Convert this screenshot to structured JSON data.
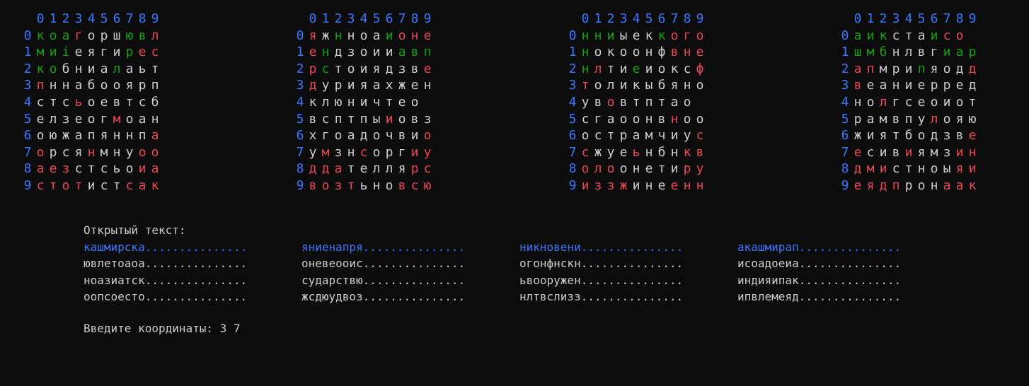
{
  "colors": {
    "background": "#0c0c0c",
    "text": "#cccccc",
    "index": "#3b78ff",
    "green": "#13a10e",
    "red": "#e74856"
  },
  "column_indices": [
    "0",
    "1",
    "2",
    "3",
    "4",
    "5",
    "6",
    "7",
    "8",
    "9"
  ],
  "row_indices": [
    "0",
    "1",
    "2",
    "3",
    "4",
    "5",
    "6",
    "7",
    "8",
    "9"
  ],
  "grids": [
    {
      "rows": [
        "коагоршювл",
        "миieягирес",
        "кобниалаьт",
        "пннабооярп",
        "стсьоевтсб",
        "елзеогмоан",
        "оюжапяннпа",
        "орсянмнуоо",
        "аезстсьоиа",
        "стотистсак"
      ],
      "colors": [
        "gggrwwwggrr",
        "gggwwwwgrrr",
        "ggwwwwgwwwr",
        "rwwwwwwwwww",
        "wwwrwwwwwww",
        "wwwwwwrwww",
        "wwwwwwwwwr",
        "rwwwrwwwrr",
        "rrrwwwwwrr",
        "rrrrwwwrrr"
      ]
    },
    {
      "rows": [
        "яжнноаионе",
        "ендзоииавп",
        "рстоиядзве",
        "дурияахжен",
        "клюничтео",
        "всптпыиовз",
        "хгоадочвио",
        "умзнсоргиу",
        "ддателлярс",
        "возтьновсю"
      ],
      "colors": [
        "rwgwwwgrrr",
        "rgwwwwwggg",
        "rgwwwwwwwr",
        "rwwwwwwwww",
        "wwwwwwwwww",
        "wwwwwwrwww",
        "wwwwwwwwwr",
        "wrwwrwwwrr",
        "rrrwwwwwrr",
        "rrrrwwwrrr"
      ]
    },
    {
      "rows": [
        "нниыекког о",
        "нокоонфвне",
        "нлтиеиоксф",
        "толикыбяно",
        "увовтптао",
        "сгаоонвноо",
        "острамчиус",
        "сжуеьнбнкв",
        "олоонетиру",
        "иззжинеенн"
      ],
      "colors": [
        "gggwwwgrrr",
        "gwwwwwwrrr",
        "grwwgwwwwr",
        "rwwwwwwwww",
        "wwrwwwwwwww",
        "wwwwwwwrww",
        "wwwwwwwwwr",
        "rwwwrwwwrr",
        "rrrwwwwwrr",
        "rrrrwwwrrr"
      ]
    },
    {
      "rows": [
        "аикстаисо",
        "шмбнлвгиар",
        "апмрипяодд",
        "веаниерред",
        "нолгсеоиот",
        "рамвпулояю",
        "жиятбодзве",
        "есивиямзин",
        "дмистноыяи",
        "еядпронаак"
      ],
      "colors": [
        "gggwwwgrrr",
        "gggwwwwggg",
        "rrwwwgwwwr",
        "rwwwwwwwww",
        "wwrwwwwwww",
        "wwwwwwrwww",
        "wwwwwwwwwr",
        "rwwwrwwwrr",
        "rrrwwwwwrr",
        "rrrrwwwrrr"
      ]
    }
  ],
  "plaintext": {
    "label": "Открытый текст:",
    "lines": [
      [
        "кашмирска...............",
        "яниенапря...............",
        "никновени...............",
        "акашмирап..............."
      ],
      [
        "ювлетоаоа...............",
        "оневеоoис...............",
        "огонфнскн...............",
        "исоадоеиа..............."
      ],
      [
        "ноазиатск...............",
        "сударствю...............",
        "ьвооружен...............",
        "индияипак..............."
      ],
      [
        "оопсоесто...............",
        "жсдюудвоз...............",
        "нлтвслизз...............",
        "ипвлемеяд..............."
      ]
    ]
  },
  "prompt": "Введите координаты: 3 7"
}
